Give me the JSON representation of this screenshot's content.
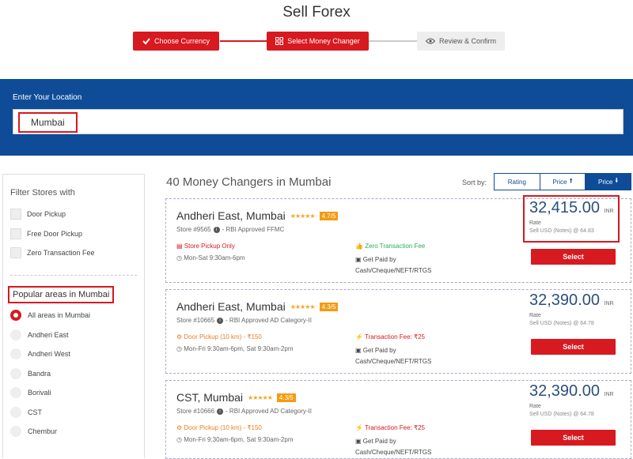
{
  "page_title": "Sell Forex",
  "steps": [
    {
      "label": "Choose Currency"
    },
    {
      "label": "Select Money Changer"
    },
    {
      "label": "Review & Confirm"
    }
  ],
  "location": {
    "label": "Enter Your Location",
    "value": "Mumbai"
  },
  "filters": {
    "title": "Filter Stores with",
    "options": [
      "Door Pickup",
      "Free Door Pickup",
      "Zero Transaction Fee"
    ]
  },
  "areas": {
    "title": "Popular areas in Mumbai",
    "options": [
      "All areas in Mumbai",
      "Andheri East",
      "Andheri West",
      "Bandra",
      "Borivali",
      "CST",
      "Chembur"
    ],
    "selected": "All areas in Mumbai"
  },
  "results": {
    "count_text": "40 Money Changers in Mumbai",
    "sort_label": "Sort by:",
    "sort_options": [
      "Rating",
      "Price",
      "Price"
    ]
  },
  "stores": [
    {
      "name": "Andheri East, Mumbai",
      "rating": "4.7/5",
      "stars": "★★★★★",
      "store_line": "Store #9565",
      "approval": "- RBI Approved FFMC",
      "service": "Store Pickup Only",
      "hours": "Mon-Sat 9:30am-6pm",
      "fee": "Zero Transaction Fee",
      "paid_1": "Get Paid by",
      "paid_2": "Cash/Cheque/NEFT/RTGS",
      "price": "32,415.00",
      "currency": "INR",
      "rate_label": "Rate",
      "sell_line": "Sell USD (Notes) @ 64.83",
      "select": "Select"
    },
    {
      "name": "Andheri East, Mumbai",
      "rating": "4.3/5",
      "stars": "★★★★★",
      "store_line": "Store #10665",
      "approval": "- RBI Approved AD Category-II",
      "service": "Door Pickup (10 km) - ₹150",
      "hours": "Mon-Fri 9:30am-6pm, Sat 9:30am-2pm",
      "fee": "Transaction Fee: ₹25",
      "paid_1": "Get Paid by",
      "paid_2": "Cash/Cheque/NEFT/RTGS",
      "price": "32,390.00",
      "currency": "INR",
      "rate_label": "Rate",
      "sell_line": "Sell USD (Notes) @ 64.78",
      "select": "Select"
    },
    {
      "name": "CST, Mumbai",
      "rating": "4.3/5",
      "stars": "★★★★★",
      "store_line": "Store #10666",
      "approval": "- RBI Approved AD Category-II",
      "service": "Door Pickup (10 km) - ₹150",
      "hours": "Mon-Fri 9:30am-6pm, Sat 9:30am-2pm",
      "fee": "Transaction Fee: ₹25",
      "paid_1": "Get Paid by",
      "paid_2": "Cash/Cheque/NEFT/RTGS",
      "price": "32,390.00",
      "currency": "INR",
      "rate_label": "Rate",
      "sell_line": "Sell USD (Notes) @ 64.78",
      "select": "Select"
    }
  ],
  "colors": {
    "brand_red": "#d71920",
    "brand_blue": "#0f4c97",
    "price_blue": "#2c4f7c"
  }
}
